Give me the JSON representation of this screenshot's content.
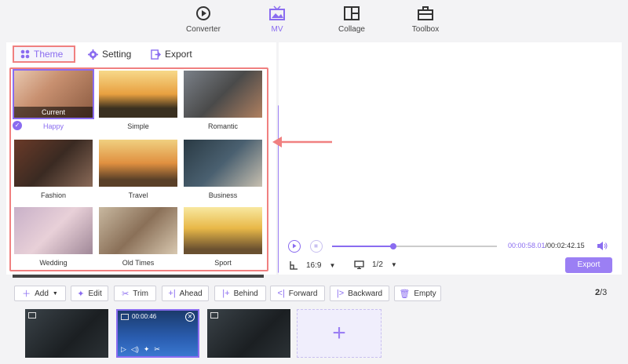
{
  "nav": {
    "items": [
      {
        "label": "Converter",
        "icon": "converter-icon"
      },
      {
        "label": "MV",
        "icon": "mv-icon",
        "active": true
      },
      {
        "label": "Collage",
        "icon": "collage-icon"
      },
      {
        "label": "Toolbox",
        "icon": "toolbox-icon"
      }
    ]
  },
  "tabs": {
    "theme": "Theme",
    "setting": "Setting",
    "export": "Export"
  },
  "themes": {
    "current_label": "Current",
    "items": [
      "Happy",
      "Simple",
      "Romantic",
      "Fashion",
      "Travel",
      "Business",
      "Wedding",
      "Old Times",
      "Sport"
    ]
  },
  "player": {
    "current_time": "00:00:58.01",
    "total_time": "/00:02:42.15",
    "progress": 0.37,
    "ratio": "16:9",
    "page": "1/2",
    "export_label": "Export"
  },
  "toolbar": {
    "add": "Add",
    "edit": "Edit",
    "trim": "Trim",
    "ahead": "Ahead",
    "behind": "Behind",
    "forward": "Forward",
    "backward": "Backward",
    "empty": "Empty",
    "page_current": "2",
    "page_total": "/3"
  },
  "timeline": {
    "active_duration": "00:00:46"
  },
  "colors": {
    "accent": "#8a6cf0",
    "highlight": "#f08080"
  }
}
